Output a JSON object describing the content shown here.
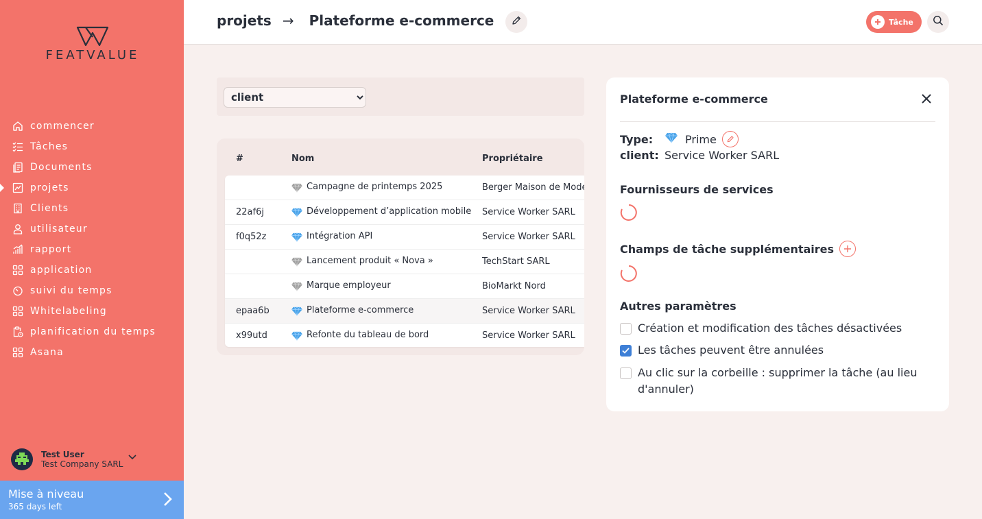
{
  "brand": {
    "name": "FEATVALUE"
  },
  "sidebar": {
    "items": [
      {
        "label": "commencer",
        "icon": "home-icon"
      },
      {
        "label": "Tâches",
        "icon": "checklist-icon"
      },
      {
        "label": "Documents",
        "icon": "documents-icon"
      },
      {
        "label": "projets",
        "icon": "chart-icon",
        "active": true
      },
      {
        "label": "Clients",
        "icon": "building-icon"
      },
      {
        "label": "utilisateur",
        "icon": "user-icon"
      },
      {
        "label": "rapport",
        "icon": "bar-chart-icon"
      },
      {
        "label": "application",
        "icon": "apps-icon"
      },
      {
        "label": "suivi du temps",
        "icon": "stopwatch-icon"
      },
      {
        "label": "Whitelabeling",
        "icon": "apps-icon"
      },
      {
        "label": "planification du temps",
        "icon": "clipboard-clock-icon"
      },
      {
        "label": "Asana",
        "icon": "apps-icon"
      }
    ]
  },
  "user": {
    "name": "Test User",
    "company": "Test Company SARL"
  },
  "upgrade": {
    "title": "Mise à niveau",
    "subtitle": "365 days left"
  },
  "header": {
    "crumb_parent": "projets",
    "crumb_arrow": "→",
    "crumb_current": "Plateforme e-commerce",
    "task_button": "Tâche"
  },
  "filter": {
    "selected": "client",
    "options": [
      "client"
    ]
  },
  "table": {
    "headers": {
      "id": "#",
      "name": "Nom",
      "owner": "Propriétaire"
    },
    "rows": [
      {
        "id": "",
        "name": "Campagne de printemps 2025",
        "owner": "Berger Maison de Mode",
        "tier": "grey"
      },
      {
        "id": "22af6j",
        "name": "Développement d’application mobile",
        "owner": "Service Worker SARL",
        "tier": "blue"
      },
      {
        "id": "f0q52z",
        "name": "Intégration API",
        "owner": "Service Worker SARL",
        "tier": "blue"
      },
      {
        "id": "",
        "name": "Lancement produit « Nova »",
        "owner": "TechStart SARL",
        "tier": "grey"
      },
      {
        "id": "",
        "name": "Marque employeur",
        "owner": "BioMarkt Nord",
        "tier": "grey"
      },
      {
        "id": "epaa6b",
        "name": "Plateforme e-commerce",
        "owner": "Service Worker SARL",
        "tier": "blue",
        "highlight": true
      },
      {
        "id": "x99utd",
        "name": "Refonte du tableau de bord",
        "owner": "Service Worker SARL",
        "tier": "blue"
      }
    ]
  },
  "panel": {
    "title": "Plateforme e-commerce",
    "type_label": "Type:",
    "type_value": "Prime",
    "client_label": "client:",
    "client_value": "Service Worker SARL",
    "providers_title": "Fournisseurs de services",
    "extra_fields_title": "Champs de tâche supplémentaires",
    "other_title": "Autres paramètres",
    "options": [
      {
        "label": "Création et modification des tâches désactivées",
        "checked": false
      },
      {
        "label": "Les tâches peuvent être annulées",
        "checked": true
      },
      {
        "label": "Au clic sur la corbeille : supprimer la tâche (au lieu d'annuler)",
        "checked": false
      }
    ]
  },
  "colors": {
    "accent": "#f3736a",
    "upgrade": "#6aa5ef",
    "gem_blue": "#4aa3e8",
    "gem_grey": "#a0a0a0"
  }
}
